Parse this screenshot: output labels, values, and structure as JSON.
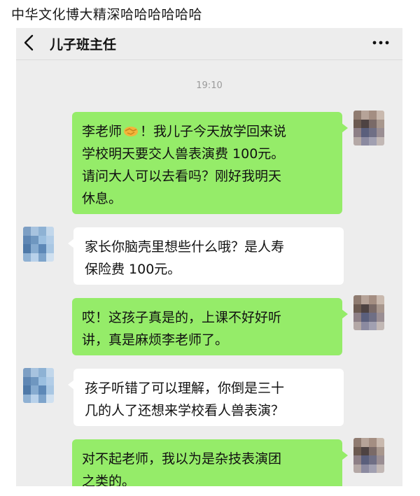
{
  "caption": "中华文化博大精深哈哈哈哈哈哈",
  "header": {
    "back_icon": "chevron-left-icon",
    "title": "儿子班主任",
    "more_icon": "more-dots-icon"
  },
  "timestamp": "19:10",
  "messages": [
    {
      "side": "sent",
      "lines": [
        "李老师",
        "！我儿子今天放学回来说",
        "学校明天要交人兽表演费 100元。",
        "请问大人可以去看吗？刚好我明天",
        "休息。"
      ],
      "emoji": "handshake-emoji"
    },
    {
      "side": "recv",
      "lines": [
        "家长你脑壳里想些什么哦？是人寿",
        "保险费 100元。"
      ]
    },
    {
      "side": "sent",
      "lines": [
        "哎！这孩子真是的，上课不好好听",
        "讲，真是麻烦李老师了。"
      ]
    },
    {
      "side": "recv",
      "lines": [
        "孩子听错了可以理解，你倒是三十",
        "几的人了还想来学校看人兽表演？"
      ]
    },
    {
      "side": "sent",
      "lines": [
        "对不起老师，我以为是杂技表演团",
        "之类的。"
      ]
    }
  ],
  "colors": {
    "sent_bubble": "#95ec69",
    "recv_bubble": "#ffffff",
    "chat_background": "#ededed"
  }
}
